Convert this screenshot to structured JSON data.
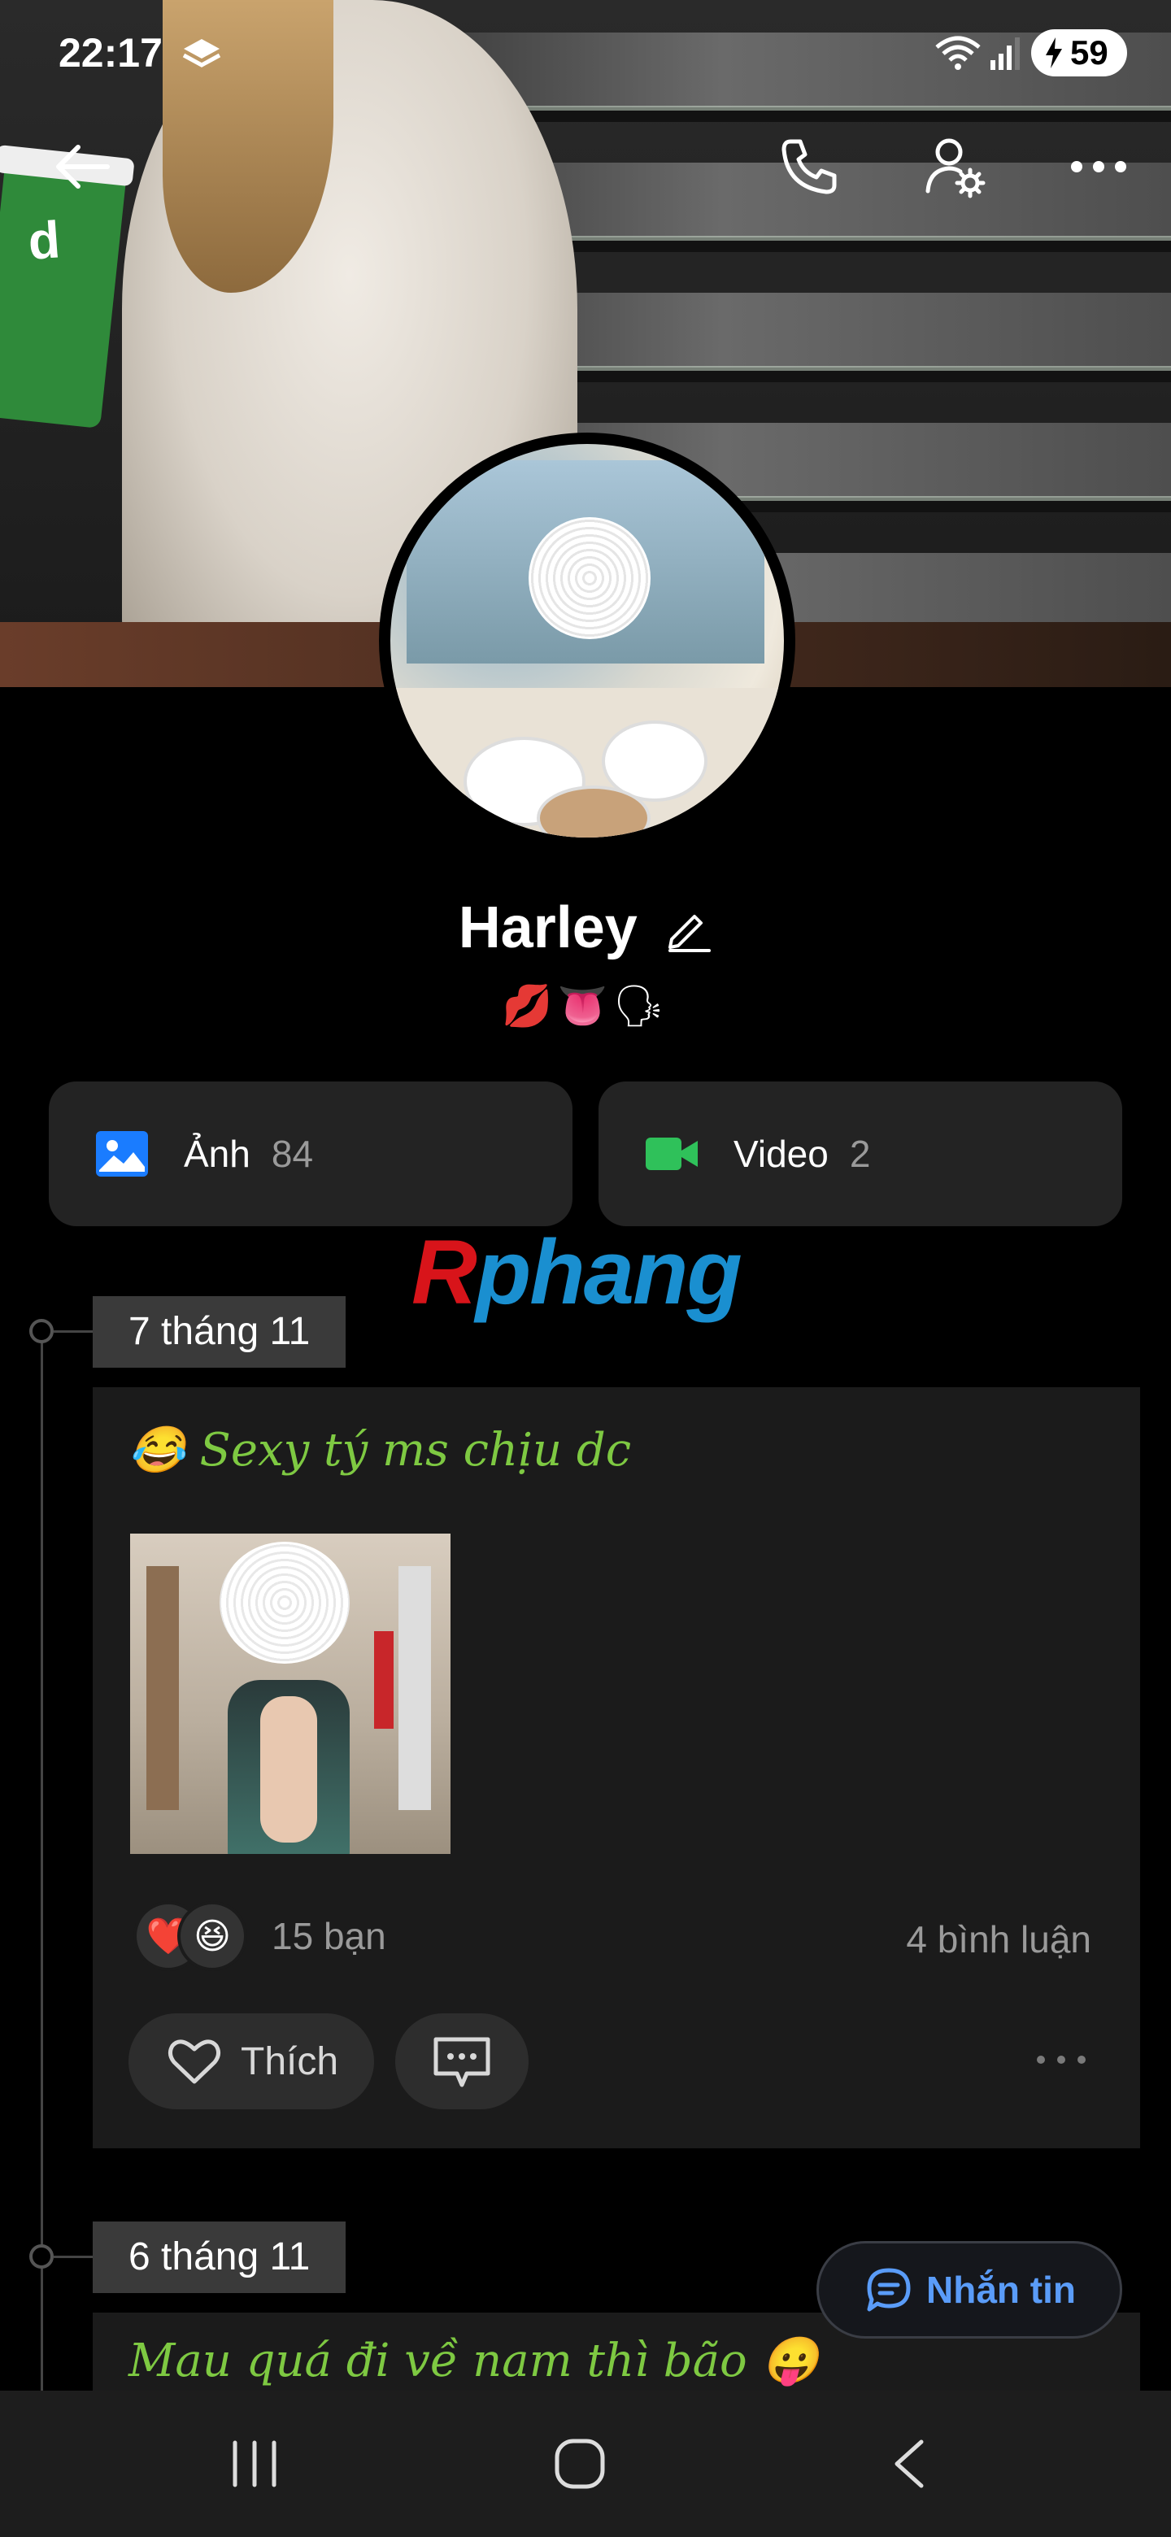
{
  "status_bar": {
    "time": "22:17",
    "battery": "59"
  },
  "profile": {
    "name": "Harley",
    "bio_emojis": "💋👅🗣"
  },
  "media": {
    "photos_label": "Ảnh",
    "photos_count": "84",
    "videos_label": "Video",
    "videos_count": "2"
  },
  "watermark": {
    "first": "R",
    "rest": "phang"
  },
  "timeline": [
    {
      "date": "7 tháng 11",
      "post_text": "😂 Sexy tý ms chịu dc",
      "reactions": [
        "❤️",
        "😆"
      ],
      "reaction_count": "15 bạn",
      "comment_count": "4 bình luận",
      "like_label": "Thích"
    },
    {
      "date": "6 tháng 11",
      "post_text": "Mau quá đi về nam thì bão 😛"
    }
  ],
  "message_button": "Nhắn tin",
  "colors": {
    "post_text": "#7ec942",
    "accent": "#5a9cf8",
    "card": "#1b1b1b"
  }
}
